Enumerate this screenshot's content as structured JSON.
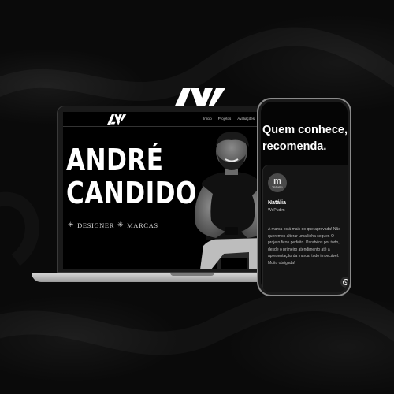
{
  "brand": {
    "logo_text": "AV"
  },
  "laptop_site": {
    "nav_logo_text": "AV",
    "nav_links": [
      "Início",
      "Projetos",
      "Avaliações"
    ],
    "hero_name_line1": "ANDRÉ",
    "hero_name_line2": "CANDIDO",
    "tag_1": "DESIGNER",
    "tag_2": "MARCAS"
  },
  "phone_site": {
    "heading": "Quem conhece, recomenda.",
    "testimonial": {
      "avatar_letter": "m",
      "avatar_sub": "WePudim",
      "name": "Natália",
      "company": "WePudim",
      "text": "A marca está mais do que aprovada! Não queremos alterar uma linha sequer. O projeto ficou perfeito. Parabéns por tudo, desde o primeiro atendimento até a apresentação da marca, tudo impecável. Muito obrigada!"
    }
  },
  "colors": {
    "background": "#0a0a0a",
    "text": "#ffffff",
    "muted": "#bdbdbd"
  }
}
